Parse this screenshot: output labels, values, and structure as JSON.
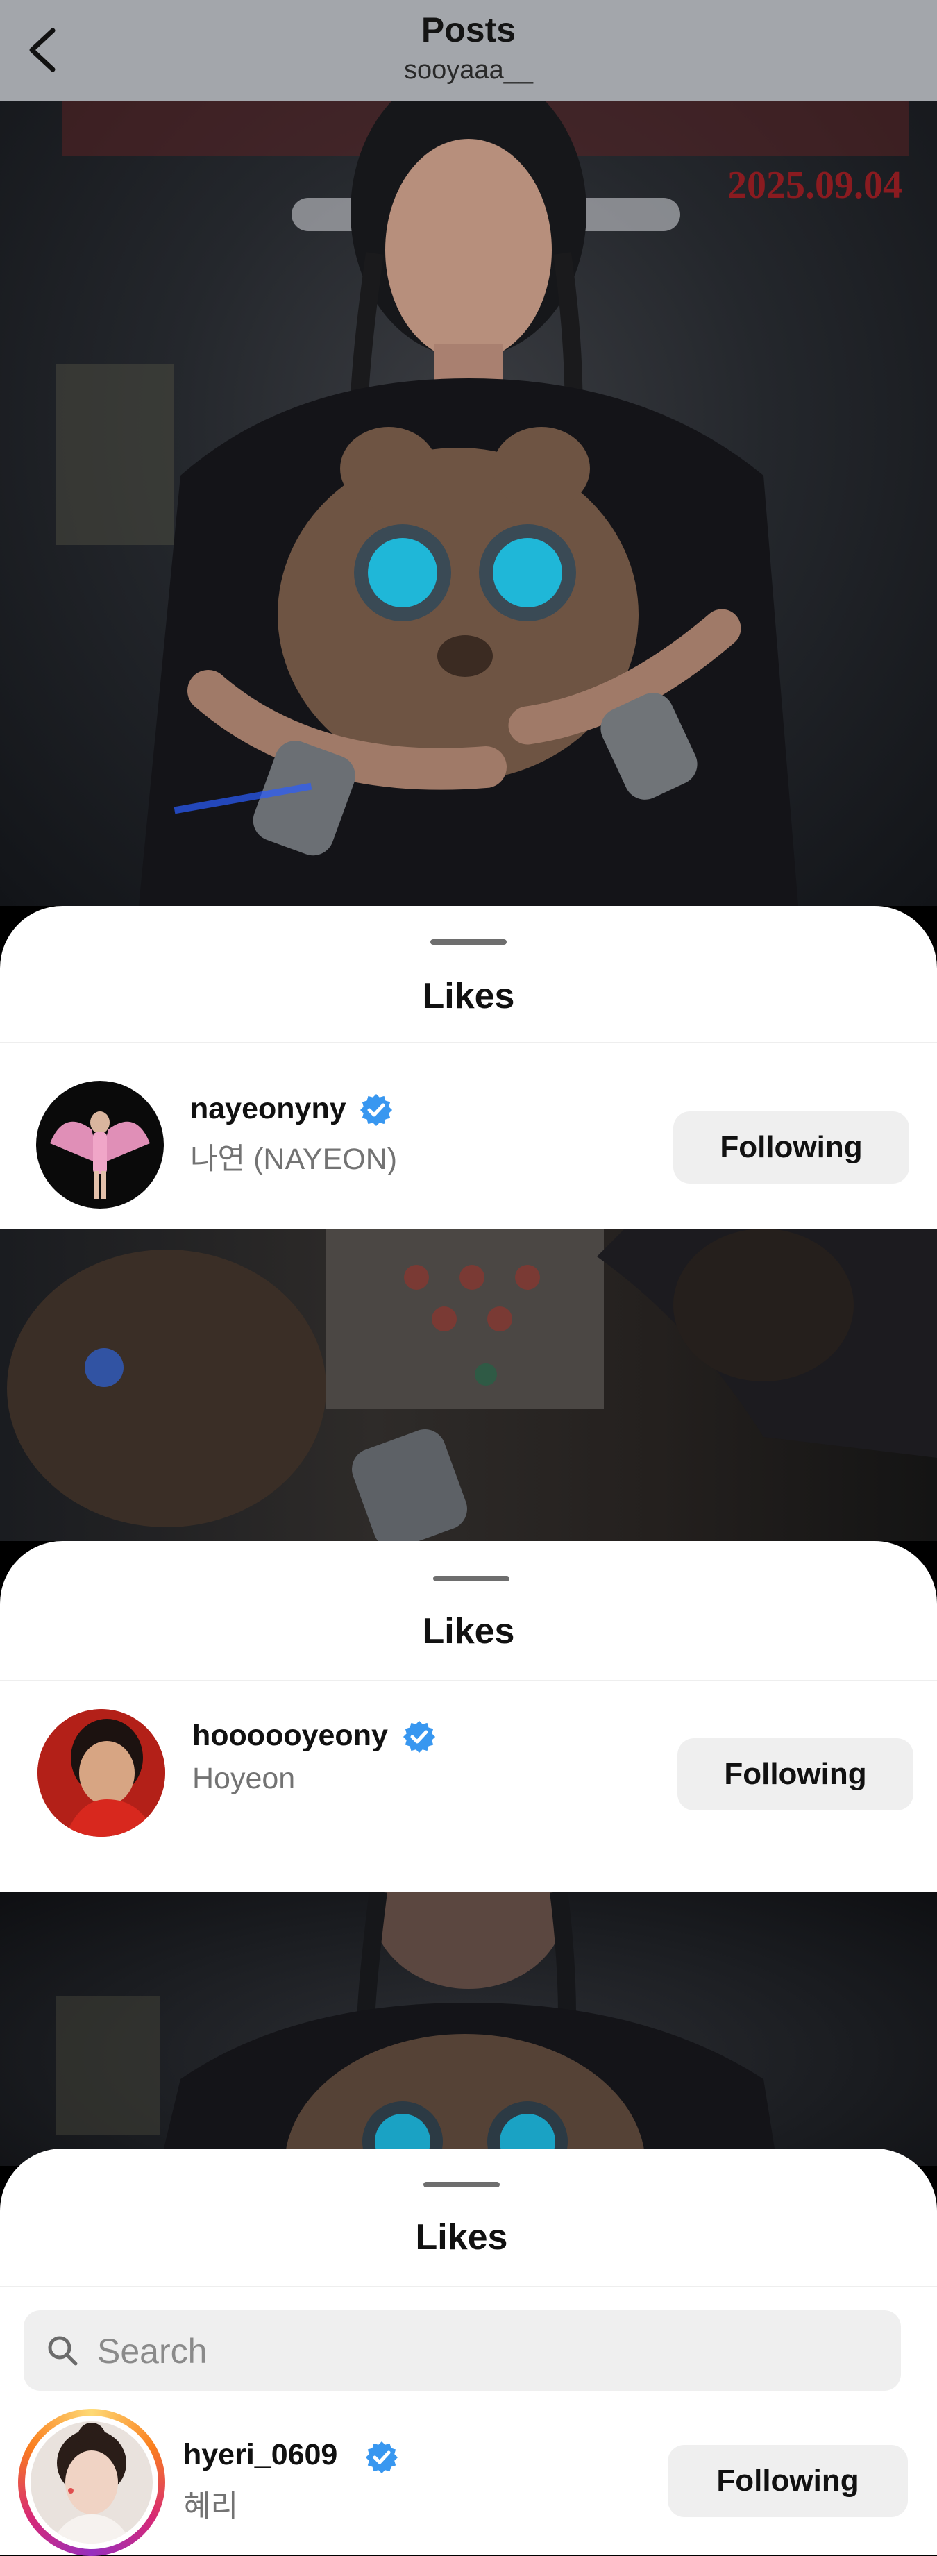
{
  "header": {
    "title": "Posts",
    "subtitle": "sooyaaa__"
  },
  "post_overlay": {
    "date_text": "2025.09.04"
  },
  "sheets": [
    {
      "title": "Likes",
      "users": [
        {
          "username": "nayeonyny",
          "full_name": "나연 (NAYEON)",
          "verified": true,
          "button_label": "Following"
        }
      ]
    },
    {
      "title": "Likes",
      "users": [
        {
          "username": "hoooooyeony",
          "full_name": "Hoyeon",
          "verified": true,
          "button_label": "Following"
        }
      ]
    },
    {
      "title": "Likes",
      "search": {
        "placeholder": "Search",
        "value": ""
      },
      "users": [
        {
          "username": "hyeri_0609",
          "full_name": "혜리",
          "verified": true,
          "button_label": "Following",
          "has_story_ring": true
        }
      ]
    }
  ],
  "colors": {
    "verified_blue": "#3897f0",
    "button_bg": "#efefef",
    "topbar_bg": "#a3a6ab",
    "story_ring": "#d62976"
  },
  "icons": {
    "back": "chevron-left-icon",
    "verified": "verified-badge-icon",
    "search": "search-icon"
  }
}
